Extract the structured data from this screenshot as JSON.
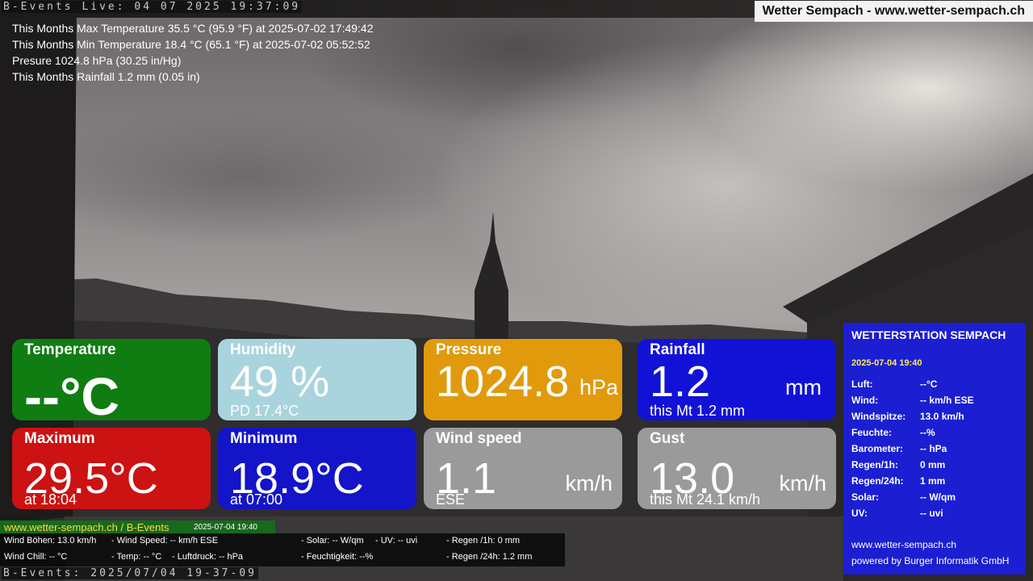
{
  "camera": {
    "stamp_top": "B-Events Live: 04 07 2025 19:37:09",
    "stamp_bottom": "B-Events: 2025/07/04 19-37-09"
  },
  "header": {
    "site_title": "Wetter Sempach - www.wetter-sempach.ch"
  },
  "month_stats": [
    "This Months Max Temperature 35.5 °C (95.9 °F) at 2025-07-02 17:49:42",
    "This Months Min Temperature 18.4 °C (65.1 °F) at 2025-07-02 05:52:52",
    "Presure 1024.8 hPa (30.25 in/Hg)",
    "This Months Rainfall 1.2 mm (0.05 in)"
  ],
  "tiles": {
    "temperature": {
      "label": "Temperature",
      "value": "--°C",
      "color": "#0f7d12"
    },
    "humidity": {
      "label": "Humidity",
      "value": "49 %",
      "sub": "PD 17.4°C",
      "color": "#a9d4dd"
    },
    "pressure": {
      "label": "Pressure",
      "value": "1024.8",
      "unit": "hPa",
      "color": "#e19a0c"
    },
    "rainfall": {
      "label": "Rainfall",
      "value": "1.2",
      "unit": "mm",
      "sub": "this Mt 1.2 mm",
      "color": "#1212d6"
    },
    "maximum": {
      "label": "Maximum",
      "value": "29.5°C",
      "sub": "at 18:04",
      "color": "#cc1212"
    },
    "minimum": {
      "label": "Minimum",
      "value": "18.9°C",
      "sub": "at 07:00",
      "color": "#1414c8"
    },
    "wind_speed": {
      "label": "Wind speed",
      "value": "1.1",
      "unit": "km/h",
      "sub": "ESE",
      "color": "#9a9a9a"
    },
    "gust": {
      "label": "Gust",
      "value": "13.0",
      "unit": "km/h",
      "sub": "this Mt 24.1 km/h",
      "color": "#9a9a9a"
    }
  },
  "station": {
    "title": "WETTERSTATION SEMPACH",
    "datetime": "2025-07-04 19:40",
    "rows": [
      {
        "key": "Luft:",
        "value": "--°C"
      },
      {
        "key": "Wind:",
        "value": "-- km/h  ESE"
      },
      {
        "key": "Windspitze:",
        "value": "13.0 km/h"
      },
      {
        "key": "Feuchte:",
        "value": "--%"
      },
      {
        "key": "Barometer:",
        "value": "-- hPa"
      },
      {
        "key": "Regen/1h:",
        "value": "0 mm"
      },
      {
        "key": "Regen/24h:",
        "value": "1 mm"
      },
      {
        "key": "Solar:",
        "value": "-- W/qm"
      },
      {
        "key": "UV:",
        "value": "-- uvi"
      }
    ],
    "site": "www.wetter-sempach.ch",
    "powered": "powered by Burger Informatik GmbH",
    "color": "#1b1fd1"
  },
  "ticker": {
    "site": "www.wetter-sempach.ch / B-Events",
    "datetime": "2025-07-04 19:40",
    "line1": {
      "wind_gust": "Wind Böhen: 13.0 km/h",
      "wind_speed": "- Wind Speed: -- km/h ESE",
      "solar": "- Solar: -- W/qm",
      "uv": "- UV: -- uvi",
      "rain_1h": "- Regen /1h:   0 mm"
    },
    "line2": {
      "wind_chill": "Wind Chill: -- °C",
      "temp": "- Temp: -- °C",
      "pressure": "- Luftdruck: -- hPa",
      "humidity": "- Feuchtigkeit: --%",
      "rain_24h": "- Regen /24h: 1.2 mm"
    }
  }
}
